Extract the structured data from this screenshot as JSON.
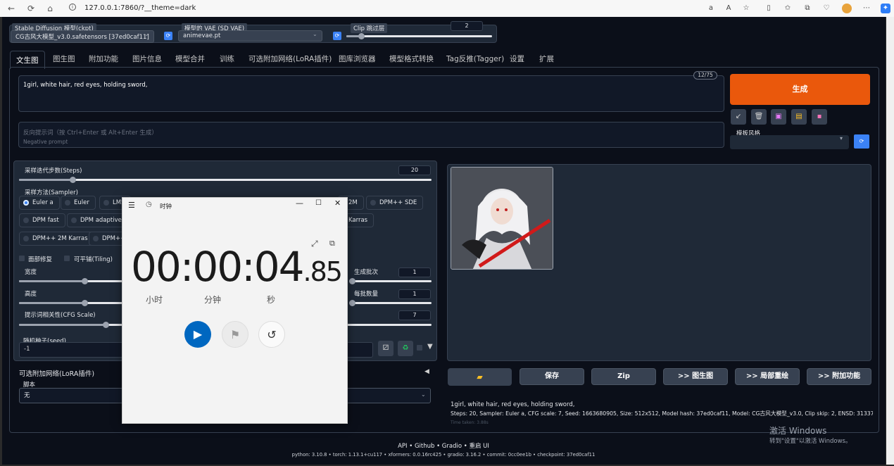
{
  "browser": {
    "url": "127.0.0.1:7860/?__theme=dark"
  },
  "top": {
    "ckpt_label": "Stable Diffusion 模型(ckpt)",
    "ckpt_value": "CG古风大模型_v3.0.safetensors [37ed0caf11]",
    "vae_label": "模型的 VAE (SD VAE)",
    "vae_value": "animevae.pt",
    "clip_label": "Clip 跳过层",
    "clip_value": "2",
    "clip_fraction": 0.1
  },
  "tabs": [
    "文生图",
    "图生图",
    "附加功能",
    "图片信息",
    "模型合并",
    "训练",
    "可选附加网络(LoRA插件)",
    "图库浏览器",
    "模型格式转换",
    "Tag反推(Tagger)",
    "设置",
    "扩展"
  ],
  "prompt": {
    "text": "1girl, white hair, red eyes, holding sword,",
    "token_count": "12/75",
    "neg_placeholder": "反向提示词（按 Ctrl+Enter 或 Alt+Enter 生成）",
    "neg_sub": "Negative prompt"
  },
  "generate": {
    "label": "生成",
    "style_label": "模板风格",
    "tool_icons": [
      "arrow-icon",
      "trash-icon",
      "image-icon",
      "clipboard-icon",
      "save-icon"
    ]
  },
  "settings": {
    "steps_label": "采样迭代步数(Steps)",
    "steps_value": "20",
    "steps_fraction": 0.13,
    "sampler_label": "采样方法(Sampler)",
    "samplers": [
      "Euler a",
      "Euler",
      "LMS",
      "2M",
      "DPM++ SDE",
      "DPM fast",
      "DPM adaptive",
      "Karras",
      "DPM++ 2M Karras",
      "DPM++"
    ],
    "restore_faces": "面部修复",
    "tiling": "可平铺(Tiling)",
    "width_label": "宽度",
    "height_label": "高度",
    "batch_count_label": "生成批次",
    "batch_count": "1",
    "batch_size_label": "每批数量",
    "batch_size": "1",
    "cfg_label": "提示词相关性(CFG Scale)",
    "cfg_value": "7",
    "seed_label": "随机种子(seed)",
    "seed_value": "-1",
    "lora_label": "可选附加网络(LoRA插件)",
    "script_label": "脚本",
    "script_value": "无"
  },
  "output": {
    "buttons": [
      "保存",
      "Zip",
      ">> 图生图",
      ">> 局部重绘",
      ">> 附加功能"
    ],
    "info_line1": "1girl, white hair, red eyes, holding sword,",
    "info_line2": "Steps: 20, Sampler: Euler a, CFG scale: 7, Seed: 1663680905, Size: 512x512, Model hash: 37ed0caf11, Model: CG古风大模型_v3.0, Clip skip: 2, ENSD: 31337",
    "time_taken": "Time taken: 3.88s"
  },
  "footer": {
    "links": "API  •  Github  •  Gradio  •  重启 UI",
    "versions": "python: 3.10.8  •  torch: 1.13.1+cu117  •  xformers: 0.0.16rc425  •  gradio: 3.16.2  •  commit: 0cc0ee1b  •  checkpoint: 37ed0caf11"
  },
  "watermark": {
    "line1": "激活 Windows",
    "line2": "转到\"设置\"以激活 Windows。"
  },
  "clock": {
    "title": "时钟",
    "hours": "00",
    "sep1": ":",
    "minutes": "00",
    "sep2": ":",
    "seconds": "04",
    "fraction": ".85",
    "unit_h": "小时",
    "unit_m": "分钟",
    "unit_s": "秒"
  },
  "colors": {
    "generate": "#ea580c",
    "accent": "#3b82f6",
    "play": "#0067c0"
  }
}
